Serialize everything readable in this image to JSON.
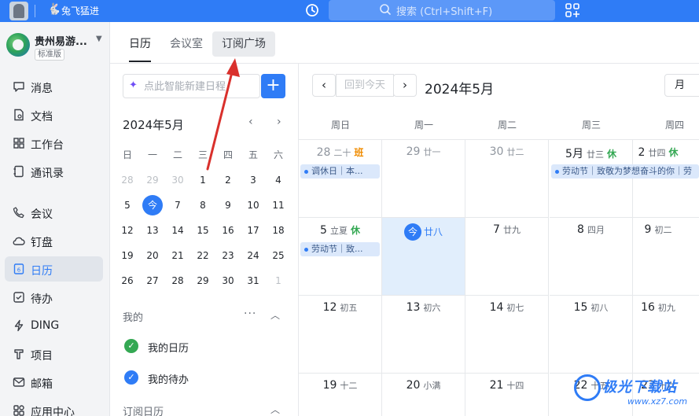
{
  "topbar": {
    "user_name": "兔飞猛进",
    "search_placeholder": "搜索 (Ctrl+Shift+F)"
  },
  "org": {
    "name": "贵州易游...",
    "badge": "标准版"
  },
  "nav": [
    {
      "label": "消息",
      "icon": "message-icon"
    },
    {
      "label": "文档",
      "icon": "document-icon"
    },
    {
      "label": "工作台",
      "icon": "workbench-icon"
    },
    {
      "label": "通讯录",
      "icon": "contacts-icon"
    },
    {
      "label": "会议",
      "icon": "meeting-icon"
    },
    {
      "label": "钉盘",
      "icon": "cloud-drive-icon"
    },
    {
      "label": "日历",
      "icon": "calendar-icon"
    },
    {
      "label": "待办",
      "icon": "todo-icon"
    },
    {
      "label": "DING",
      "icon": "ding-icon"
    },
    {
      "label": "项目",
      "icon": "project-icon"
    },
    {
      "label": "邮箱",
      "icon": "mail-icon"
    },
    {
      "label": "应用中心",
      "icon": "app-center-icon"
    }
  ],
  "tabs": [
    "日历",
    "会议室",
    "订阅广场"
  ],
  "mini": {
    "ai_placeholder": "点此智能新建日程",
    "add_label": "+",
    "title": "2024年5月",
    "prev": "‹",
    "next": "›",
    "weekdays": [
      "日",
      "一",
      "二",
      "三",
      "四",
      "五",
      "六"
    ],
    "weeks": [
      [
        "28",
        "29",
        "30",
        "1",
        "2",
        "3",
        "4"
      ],
      [
        "5",
        "今",
        "7",
        "8",
        "9",
        "10",
        "11"
      ],
      [
        "12",
        "13",
        "14",
        "15",
        "16",
        "17",
        "18"
      ],
      [
        "19",
        "20",
        "21",
        "22",
        "23",
        "24",
        "25"
      ],
      [
        "26",
        "27",
        "28",
        "29",
        "30",
        "31",
        "1"
      ]
    ],
    "my_section": "我的",
    "my_dots": "···",
    "my_calendar": "我的日历",
    "my_todo": "我的待办",
    "subscribed_section": "订阅日历",
    "colors": {
      "my_calendar": "#34a853",
      "my_todo": "#2f7cf6"
    }
  },
  "main": {
    "today_button": "回到今天",
    "month_title": "2024年5月",
    "view": "月",
    "weekdays": [
      "周日",
      "周一",
      "周二",
      "周三",
      "周四"
    ],
    "rows": [
      [
        {
          "num": "28",
          "lunar": "二十",
          "badge": "班",
          "muted": true,
          "event": "调休日｜本..."
        },
        {
          "num": "29",
          "lunar": "廿一",
          "muted": true
        },
        {
          "num": "30",
          "lunar": "廿二",
          "muted": true
        },
        {
          "num": "5月",
          "lunar": "廿三",
          "badge": "休",
          "event": "劳动节｜致敬为梦想奋斗的你｜劳"
        },
        {
          "num": "2",
          "lunar": "廿四",
          "badge": "休"
        }
      ],
      [
        {
          "num": "5",
          "lunar": "立夏",
          "badge": "休",
          "event": "劳动节｜致..."
        },
        {
          "num": "今",
          "lunar": "廿八",
          "today": true
        },
        {
          "num": "7",
          "lunar": "廿九"
        },
        {
          "num": "8",
          "lunar": "四月"
        },
        {
          "num": "9",
          "lunar": "初二"
        }
      ],
      [
        {
          "num": "12",
          "lunar": "初五"
        },
        {
          "num": "13",
          "lunar": "初六"
        },
        {
          "num": "14",
          "lunar": "初七"
        },
        {
          "num": "15",
          "lunar": "初八"
        },
        {
          "num": "16",
          "lunar": "初九"
        }
      ],
      [
        {
          "num": "19",
          "lunar": "十二"
        },
        {
          "num": "20",
          "lunar": "小满"
        },
        {
          "num": "21",
          "lunar": "十四"
        },
        {
          "num": "22",
          "lunar": "十五"
        },
        {
          "num": "23",
          "lunar": "十六"
        }
      ]
    ]
  },
  "watermark": {
    "text": "极光下载站",
    "url": "www.xz7.com"
  },
  "colors": {
    "accent": "#2f7cf6",
    "annotation_arrow": "#d9302c"
  }
}
